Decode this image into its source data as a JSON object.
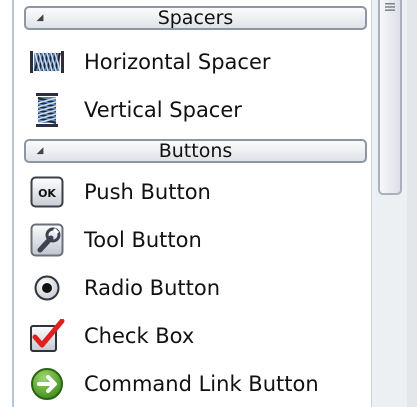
{
  "widget_box": {
    "sections": [
      {
        "title": "Spacers",
        "items": [
          {
            "label": "Horizontal Spacer",
            "icon": "horizontal-spacer-icon"
          },
          {
            "label": "Vertical Spacer",
            "icon": "vertical-spacer-icon"
          }
        ]
      },
      {
        "title": "Buttons",
        "items": [
          {
            "label": "Push Button",
            "icon": "push-button-icon",
            "icon_text": "OK"
          },
          {
            "label": "Tool Button",
            "icon": "tool-button-icon"
          },
          {
            "label": "Radio Button",
            "icon": "radio-button-icon"
          },
          {
            "label": "Check Box",
            "icon": "check-box-icon"
          },
          {
            "label": "Command Link Button",
            "icon": "command-link-icon"
          }
        ]
      }
    ]
  },
  "colors": {
    "header_border": "#8d96a3",
    "check_mark": "#e02020",
    "command_link_green": "#4a9a22"
  }
}
